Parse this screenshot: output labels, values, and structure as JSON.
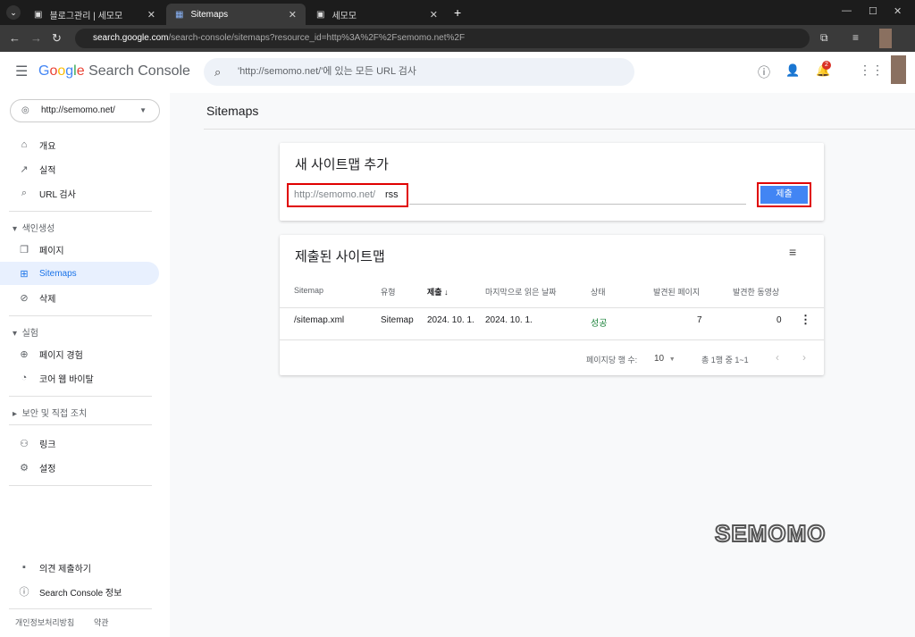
{
  "browser": {
    "tabs": [
      {
        "title": "블로그관리 | 세모모"
      },
      {
        "title": "Sitemaps"
      },
      {
        "title": "세모모"
      }
    ],
    "url_host": "search.google.com",
    "url_path": "/search-console/sitemaps?resource_id=http%3A%2F%2Fsemomo.net%2F"
  },
  "header": {
    "logo_google": "Google",
    "logo_product": "Search Console",
    "search_placeholder": "'http://semomo.net/'에 있는 모든 URL 검사",
    "notifications": "2"
  },
  "sidebar": {
    "property": "http://semomo.net/",
    "items": [
      {
        "label": "개요",
        "icon": "home-icon"
      },
      {
        "label": "실적",
        "icon": "trending-icon"
      },
      {
        "label": "URL 검사",
        "icon": "search-icon"
      }
    ],
    "section_indexing": "색인생성",
    "indexing_items": [
      {
        "label": "페이지",
        "icon": "pages-icon"
      },
      {
        "label": "Sitemaps",
        "icon": "sitemap-icon"
      },
      {
        "label": "삭제",
        "icon": "eye-off-icon"
      }
    ],
    "section_experience": "실험",
    "experience_items": [
      {
        "label": "페이지 경험",
        "icon": "plus-circle-icon"
      },
      {
        "label": "코어 웹 바이탈",
        "icon": "gauge-icon"
      }
    ],
    "section_security": "보안 및 직접 조치",
    "other_items": [
      {
        "label": "링크",
        "icon": "links-icon"
      },
      {
        "label": "설정",
        "icon": "gear-icon"
      }
    ],
    "bottom_items": [
      {
        "label": "의견 제출하기",
        "icon": "feedback-icon"
      },
      {
        "label": "Search Console 정보",
        "icon": "info-icon"
      }
    ],
    "footer": {
      "privacy": "개인정보처리방침",
      "terms": "약관"
    }
  },
  "main": {
    "title": "Sitemaps",
    "add_card": {
      "title": "새 사이트맵 추가",
      "prefix": "http://semomo.net/",
      "value": "rss",
      "submit": "제출"
    },
    "list_card": {
      "title": "제출된 사이트맵",
      "columns": [
        "Sitemap",
        "유형",
        "제출",
        "마지막으로 읽은 날짜",
        "상태",
        "발견된 페이지",
        "발견한 동영상"
      ],
      "rows": [
        {
          "sitemap": "/sitemap.xml",
          "type": "Sitemap",
          "submitted": "2024. 10. 1.",
          "last_read": "2024. 10. 1.",
          "status": "성공",
          "pages": "7",
          "videos": "0"
        }
      ],
      "rows_per_page_label": "페이지당 행 수:",
      "rows_per_page": "10",
      "range": "총 1행 중 1~1"
    }
  },
  "watermark": "SEMOMO",
  "colors": {
    "accent": "#1a73e8",
    "success": "#188038",
    "highlight": "#e00000",
    "submit": "#4285f4"
  }
}
